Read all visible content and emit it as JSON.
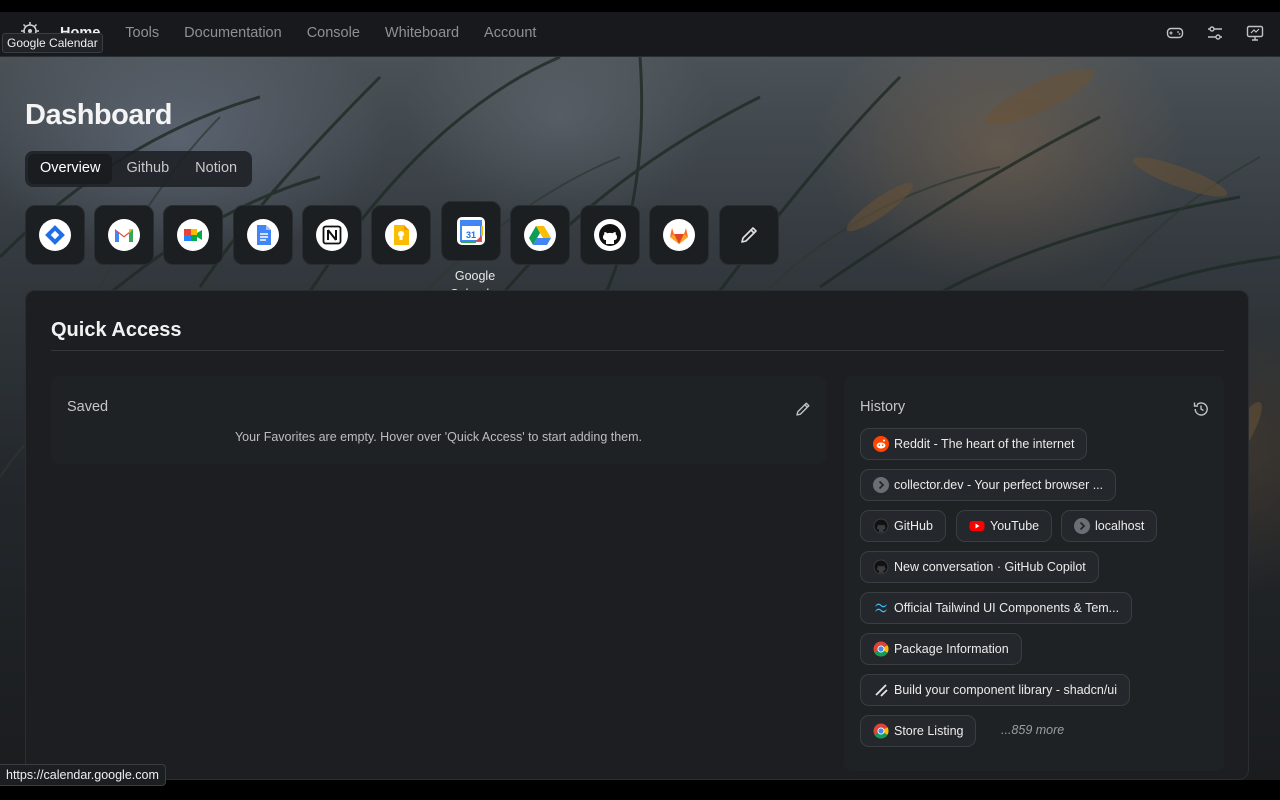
{
  "nav": {
    "items": [
      {
        "label": "Home",
        "active": true
      },
      {
        "label": "Tools",
        "active": false
      },
      {
        "label": "Documentation",
        "active": false
      },
      {
        "label": "Console",
        "active": false
      },
      {
        "label": "Whiteboard",
        "active": false
      },
      {
        "label": "Account",
        "active": false
      }
    ],
    "right_icons": [
      "gamepad-icon",
      "sliders-icon",
      "monitor-icon"
    ]
  },
  "top_tooltip": "Google Calendar",
  "page_title": "Dashboard",
  "tabs": [
    {
      "label": "Overview",
      "active": true
    },
    {
      "label": "Github",
      "active": false
    },
    {
      "label": "Notion",
      "active": false
    }
  ],
  "apps": [
    {
      "icon": "jira-icon"
    },
    {
      "icon": "gmail-icon"
    },
    {
      "icon": "google-meet-icon"
    },
    {
      "icon": "google-docs-icon"
    },
    {
      "icon": "notion-icon"
    },
    {
      "icon": "google-keep-icon"
    },
    {
      "icon": "google-calendar-icon",
      "label": "Google Calendar",
      "hovered": true
    },
    {
      "icon": "google-drive-icon"
    },
    {
      "icon": "github-icon"
    },
    {
      "icon": "gitlab-icon"
    },
    {
      "icon": "pencil-icon"
    }
  ],
  "quick_access": {
    "title": "Quick Access",
    "saved": {
      "title": "Saved",
      "empty_message": "Your Favorites are empty. Hover over 'Quick Access' to start adding them."
    },
    "history": {
      "title": "History",
      "items": [
        {
          "label": "Reddit - The heart of the internet",
          "icon": "reddit-icon"
        },
        {
          "label": "collector.dev - Your perfect browser ...",
          "icon": "chevron-circle-icon"
        },
        {
          "label": "GitHub",
          "icon": "github-icon"
        },
        {
          "label": "YouTube",
          "icon": "youtube-icon"
        },
        {
          "label": "localhost",
          "icon": "chevron-circle-icon"
        },
        {
          "label": "New conversation · GitHub Copilot",
          "icon": "github-icon"
        },
        {
          "label": "Official Tailwind UI Components & Tem...",
          "icon": "tailwind-icon"
        },
        {
          "label": "Package Information",
          "icon": "chrome-icon"
        },
        {
          "label": "Build your component library - shadcn/ui",
          "icon": "shadcn-icon"
        },
        {
          "label": "Store Listing",
          "icon": "chrome-icon"
        }
      ],
      "more_label": "...859 more"
    }
  },
  "status_url": "https://calendar.google.com"
}
